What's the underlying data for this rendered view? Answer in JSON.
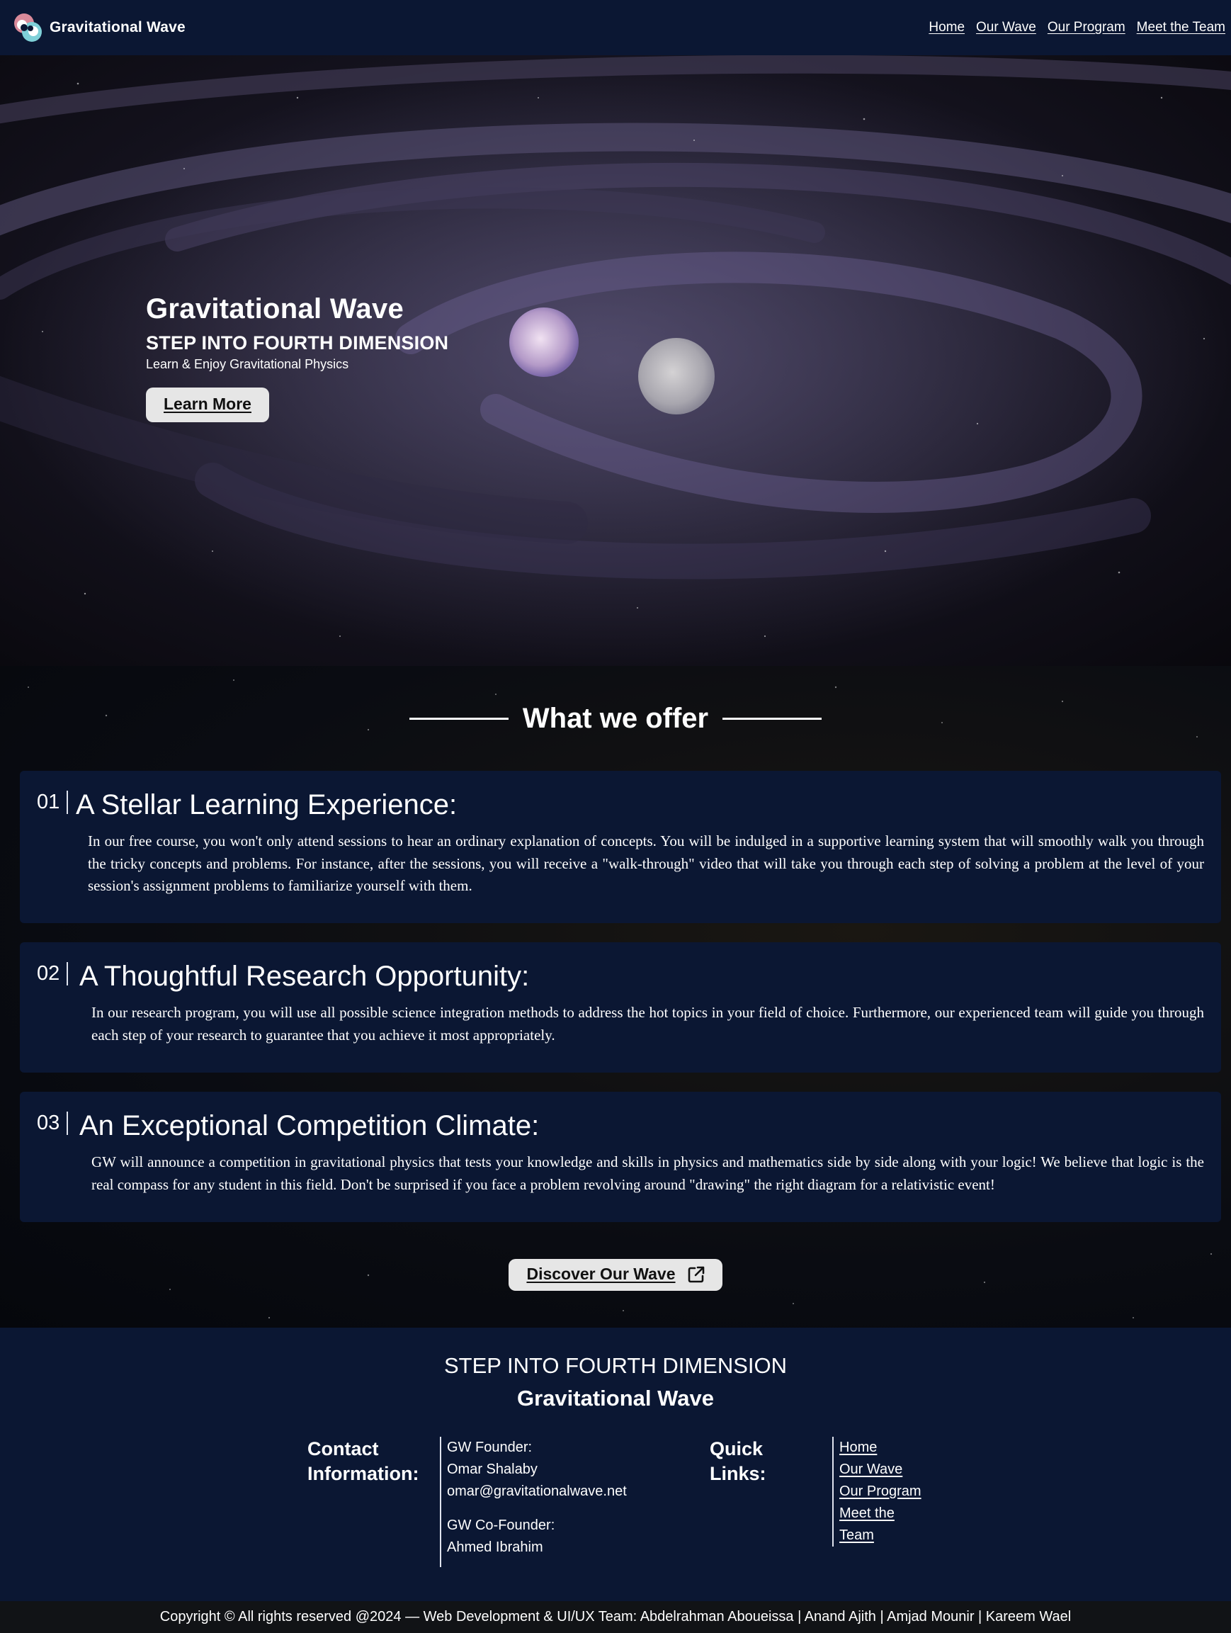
{
  "navbar": {
    "brand": "Gravitational Wave",
    "links": [
      "Home",
      "Our Wave",
      "Our Program",
      "Meet the Team"
    ]
  },
  "hero": {
    "title": "Gravitational Wave",
    "subtitle": "STEP INTO FOURTH DIMENSION",
    "tagline": "Learn & Enjoy Gravitational Physics",
    "cta": "Learn More"
  },
  "offer": {
    "heading": "What we offer",
    "cards": [
      {
        "number": "01",
        "title": "A Stellar Learning Experience:",
        "text": "In our free course, you won't only attend sessions to hear an ordinary explanation of concepts. You will be indulged in a supportive learning system that will smoothly walk you through the tricky concepts and problems. For instance, after the sessions, you will receive a \"walk-through\" video that will take you through each step of solving a problem at the level of your session's assignment problems to familiarize yourself with them."
      },
      {
        "number": "02",
        "title": "A Thoughtful Research Opportunity:",
        "text": "In our research program, you will use all possible science integration methods to address the hot topics in your field of choice. Furthermore, our experienced team will guide you through each step of your research to guarantee that you achieve it most appropriately."
      },
      {
        "number": "03",
        "title": "An Exceptional Competition Climate:",
        "text": "GW will announce a competition in gravitational physics that tests your knowledge and skills in physics and mathematics side by side along with your logic! We believe that logic is the real compass for any student in this field. Don't be surprised if you face a problem revolving around \"drawing\" the right diagram for a relativistic event!"
      }
    ],
    "discover": "Discover Our Wave",
    "discover_icon": "external-link-icon"
  },
  "footer": {
    "step": "STEP INTO FOURTH DIMENSION",
    "brand": "Gravitational Wave",
    "contact_heading_1": "Contact",
    "contact_heading_2": "Information:",
    "founder_label": "GW Founder:",
    "founder_name": "Omar Shalaby",
    "founder_email": "omar@gravitationalwave.net",
    "cofounder_label": "GW Co-Founder:",
    "cofounder_name": "Ahmed Ibrahim",
    "quick_heading_1": "Quick",
    "quick_heading_2": "Links:",
    "quick_links": [
      "Home",
      "Our Wave",
      "Our Program",
      "Meet the",
      "Team"
    ]
  },
  "copyright": "Copyright © All rights reserved @2024 — Web Development & UI/UX Team: Abdelrahman Aboueissa | Anand Ajith | Amjad Mounir | Kareem Wael",
  "colors": {
    "navy": "#0b1733",
    "button": "#e6e6e6",
    "copyright_bar": "#111316"
  }
}
